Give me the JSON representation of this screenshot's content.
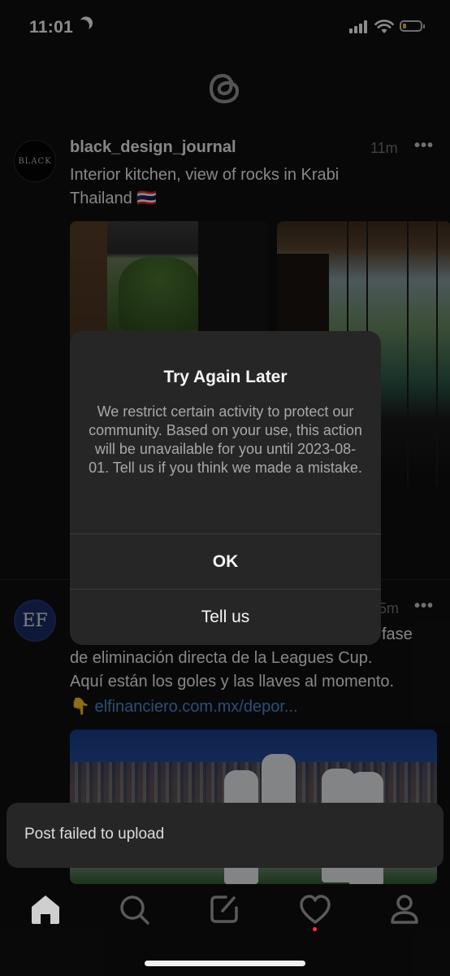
{
  "status_bar": {
    "time": "11:01",
    "battery_color": "#f2c230"
  },
  "app": {
    "logo_icon": "threads-logo-icon"
  },
  "feed": {
    "posts": [
      {
        "avatar_text": "BLACK",
        "username": "black_design_journal",
        "time": "11m",
        "more_label": "•••",
        "text_line1": "Interior kitchen, view of rocks in Krabi",
        "text_line2": "Thailand 🇹🇭"
      },
      {
        "avatar_text": "EF",
        "time": "5m",
        "more_label": "•••",
        "text_line0": "fase",
        "text_line1": "de eliminación directa de la Leagues Cup.",
        "text_line2": "Aquí están los goles y las llaves al momento.",
        "emoji": "👇",
        "link": "elfinanciero.com.mx/depor..."
      }
    ]
  },
  "dialog": {
    "title": "Try Again Later",
    "body": "We restrict certain activity to protect our community. Based on your use, this action will be unavailable for you until 2023-08-01. Tell us if you think we made a mistake.",
    "ok_label": "OK",
    "tell_us_label": "Tell us"
  },
  "toast": {
    "message": "Post failed to upload"
  },
  "tab_bar": {
    "tabs": [
      "home-icon",
      "search-icon",
      "compose-icon",
      "heart-icon",
      "profile-icon"
    ],
    "notification_color": "#ff3040"
  }
}
